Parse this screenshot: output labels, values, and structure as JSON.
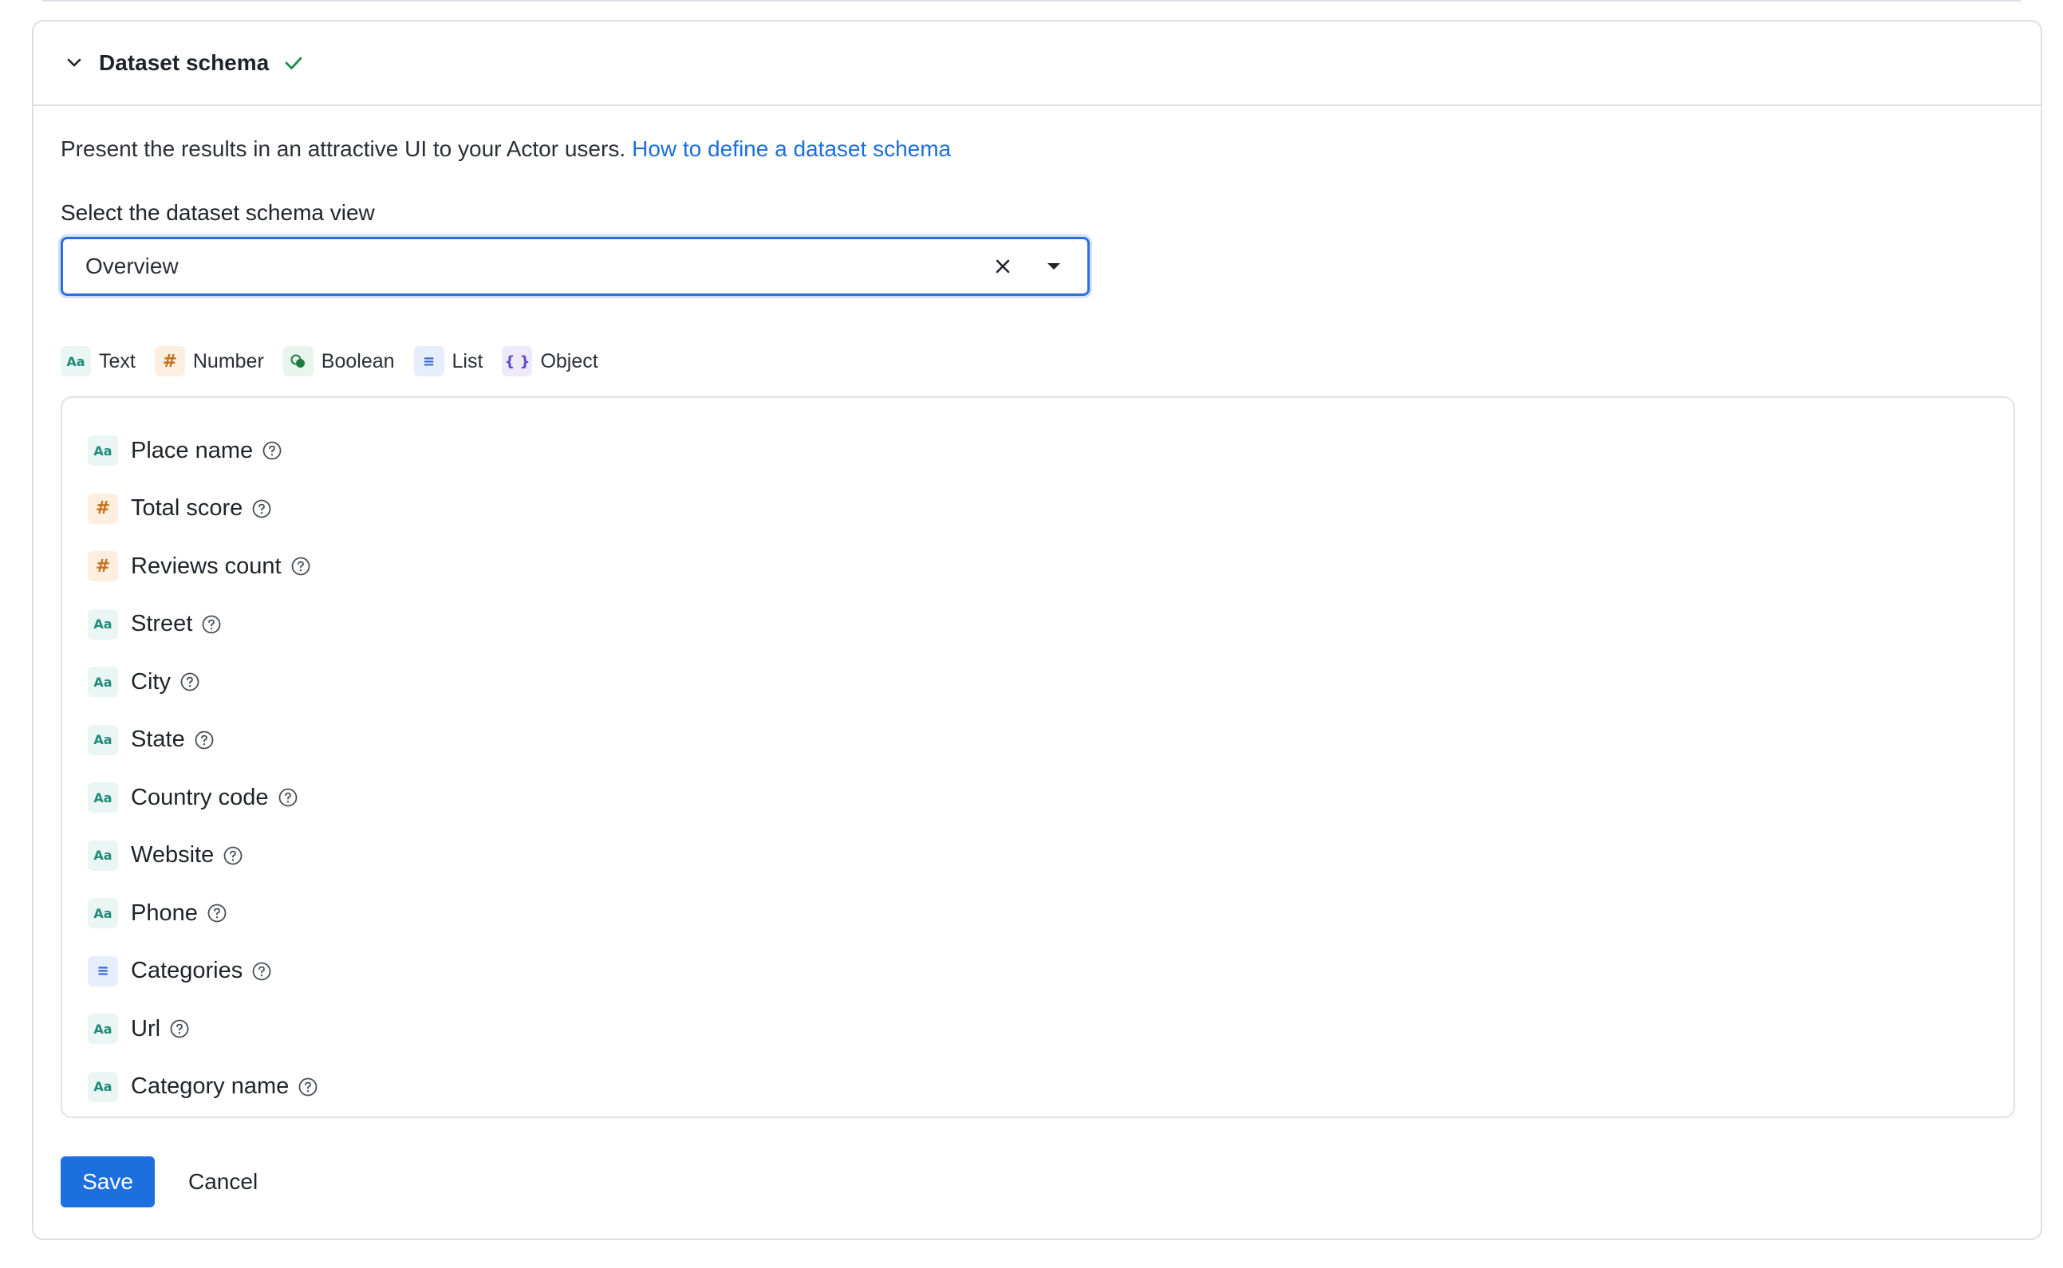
{
  "section": {
    "title": "Dataset schema",
    "status_icon": "check-icon",
    "intro_text": "Present the results in an attractive UI to your Actor users.",
    "intro_link": "How to define a dataset schema"
  },
  "select": {
    "label": "Select the dataset schema view",
    "value": "Overview"
  },
  "legend": [
    {
      "type": "text",
      "glyph": "Aa",
      "label": "Text"
    },
    {
      "type": "number",
      "glyph": "#",
      "label": "Number"
    },
    {
      "type": "boolean",
      "glyph": "",
      "label": "Boolean"
    },
    {
      "type": "list",
      "glyph": "≡",
      "label": "List"
    },
    {
      "type": "object",
      "glyph": "{ }",
      "label": "Object"
    }
  ],
  "fields": [
    {
      "name": "Place name",
      "type": "text"
    },
    {
      "name": "Total score",
      "type": "number"
    },
    {
      "name": "Reviews count",
      "type": "number"
    },
    {
      "name": "Street",
      "type": "text"
    },
    {
      "name": "City",
      "type": "text"
    },
    {
      "name": "State",
      "type": "text"
    },
    {
      "name": "Country code",
      "type": "text"
    },
    {
      "name": "Website",
      "type": "text"
    },
    {
      "name": "Phone",
      "type": "text"
    },
    {
      "name": "Categories",
      "type": "list"
    },
    {
      "name": "Url",
      "type": "text"
    },
    {
      "name": "Category name",
      "type": "text"
    }
  ],
  "actions": {
    "save_label": "Save",
    "cancel_label": "Cancel"
  },
  "colors": {
    "accent": "#1d6fe0",
    "link": "#1b6fd8",
    "success": "#1e8a4a"
  }
}
